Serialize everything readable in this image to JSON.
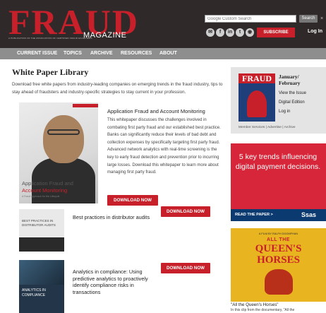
{
  "header": {
    "logo_word": "FRAUD",
    "logo_magazine": "MAGAZINE",
    "logo_tagline": "A PUBLICATION OF THE ASSOCIATION OF CERTIFIED FRAUD EXAMINERS",
    "search_placeholder": "Google Custom Search",
    "search_button": "Search",
    "search_close": "×",
    "social": [
      "✉",
      "f",
      "in",
      "t",
      "◉"
    ],
    "subscribe": "SUBSCRIBE",
    "login": "Log In"
  },
  "nav": {
    "items": [
      "CURRENT ISSUE",
      "TOPICS",
      "ARCHIVE",
      "RESOURCES",
      "ABOUT"
    ]
  },
  "main": {
    "title": "White Paper Library",
    "intro": "Download free white papers from industry-leading companies on emerging trends in the fraud industry, tips to stay ahead of fraudsters and industry-specific strategies to stay current in your profession.",
    "feature": {
      "image_badge": "",
      "image_caption_1": "Application Fraud and",
      "image_caption_2": "Account Monitoring",
      "image_sub": "A Fraud Approach for the Lifecycle",
      "title": "Application Fraud and Account Monitoring",
      "description": "This whitepaper discusses the challenges involved in combating first party fraud and our established best practice. Banks can significantly reduce their levels of bad debt and collection expenses by specifically targeting first party fraud. Advanced network analytics with real-time screening is the key to early fraud detection and prevention prior to incurring large losses. Download this whitepaper to learn more about managing first party fraud.",
      "download": "DOWNLOAD NOW"
    },
    "items": [
      {
        "image_text": "BEST PRACTICES IN DISTRIBUTOR AUDITS",
        "title": "Best practices in distributor audits",
        "download": "DOWNLOAD NOW"
      },
      {
        "image_text": "ANALYTICS IN COMPLIANCE",
        "title": "Analytics in compliance: Using predictive analytics to proactively identify compliance risks in transactions",
        "download": "DOWNLOAD NOW"
      }
    ]
  },
  "sidebar": {
    "issue_month_1": "January/",
    "issue_month_2": "February",
    "cover_logo": "FRAUD",
    "links": [
      "View the Issue",
      "Digital Edition",
      "Log in"
    ],
    "footer": "Member Services  |  Advertise  |  Archive"
  },
  "ads": {
    "sas_text": "5 key trends influencing digital payment decisions.",
    "sas_read": "READ THE PAPER >",
    "sas_logo": "Ssas",
    "movie_top": "A FILM BY RALPH DOOMPHAN",
    "movie_title_1": "ALL THE",
    "movie_title_2": "QUEEN'S",
    "movie_title_3": "HORSES",
    "movie_caption": "\"All the Queen's Horses\"",
    "movie_caption_sub": "In this clip from the documentary, \"All the"
  },
  "colors": {
    "brand_red": "#c8202a",
    "header_bg": "#2f2a29",
    "nav_bg": "#8e8e8e",
    "sidebar_bg": "#e4e4e4",
    "sas_blue": "#0a3a6f",
    "movie_yellow": "#e8b420"
  }
}
